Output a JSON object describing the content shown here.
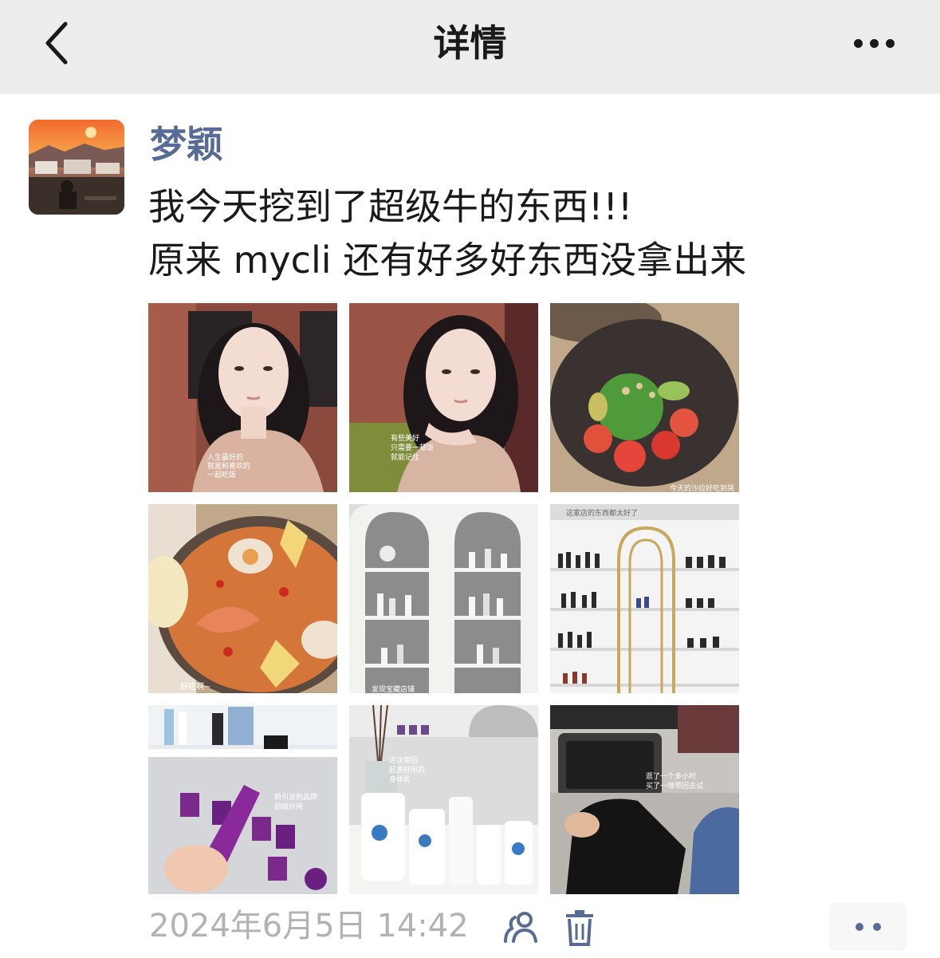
{
  "header": {
    "title": "详情",
    "back_icon": "chevron-left-icon",
    "more_icon": "ellipsis-icon"
  },
  "post": {
    "author": "梦颖",
    "avatar": "sunset-avatar",
    "text_lines": [
      "我今天挖到了超级牛的东西!!!",
      "原来 mycli 还有好多好东西没拿出来"
    ],
    "photos": [
      {
        "desc": "selfie-restaurant-1",
        "caption_lines": [
          "人生最好的",
          "就是和喜欢的",
          "一起吃饭"
        ]
      },
      {
        "desc": "selfie-restaurant-2",
        "caption_lines": [
          "有些美好",
          "只需要一顿饭",
          "就能记住"
        ]
      },
      {
        "desc": "avocado-salad",
        "caption_lines": [
          "今天的沙拉好吃到哭"
        ]
      },
      {
        "desc": "seafood-paella",
        "caption_lines": [
          "好吃啊~"
        ]
      },
      {
        "desc": "white-shelf-products",
        "caption_lines": [
          "发现宝藏店铺"
        ]
      },
      {
        "desc": "gold-shelf-products",
        "caption_lines": [
          "这家店的东西都太好了"
        ]
      },
      {
        "desc": "purple-skincare",
        "caption_lines": [
          "新引进的品牌",
          "超级好用"
        ]
      },
      {
        "desc": "lotion-bottles",
        "caption_lines": [
          "这次带回",
          "超多好用的",
          "身体乳"
        ]
      },
      {
        "desc": "car-interior-bag",
        "caption_lines": [
          "逛了一个多小时",
          "买了一堆带回去试"
        ]
      }
    ]
  },
  "footer": {
    "timestamp": "2024年6月5日 14:42",
    "privacy_icon": "people-icon",
    "delete_icon": "trash-icon",
    "more_icon": "comment-dots-icon"
  },
  "colors": {
    "nav_bg": "#ededed",
    "link": "#576b95",
    "text": "#1a1a1a",
    "meta": "#b2b2b2"
  }
}
